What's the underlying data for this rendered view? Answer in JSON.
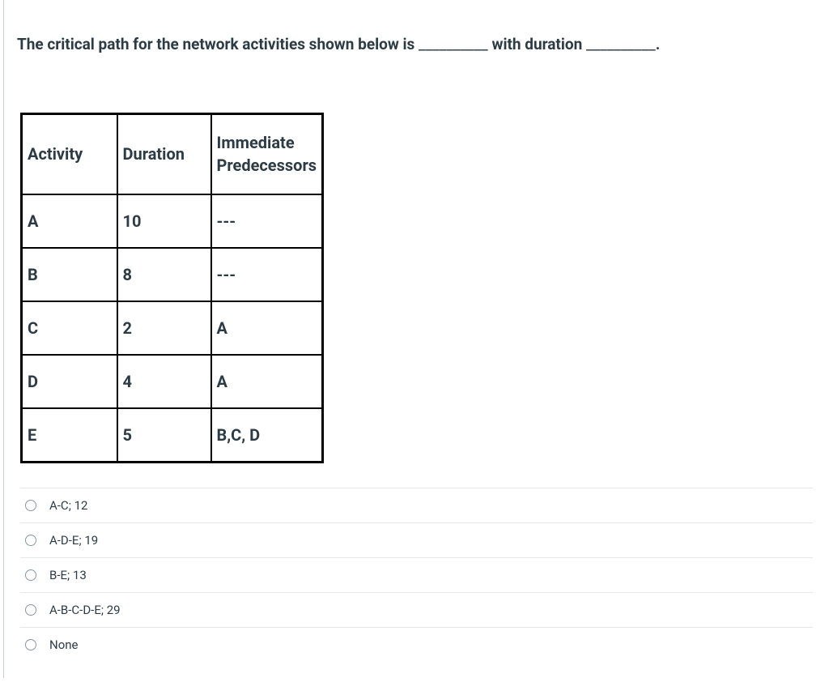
{
  "chart_data": {
    "type": "table",
    "columns": [
      "Activity",
      "Duration",
      "Immediate Predecessors"
    ],
    "rows": [
      [
        "A",
        "10",
        "---"
      ],
      [
        "B",
        "8",
        "---"
      ],
      [
        "C",
        "2",
        "A"
      ],
      [
        "D",
        "4",
        "A"
      ],
      [
        "E",
        "5",
        "B,C, D"
      ]
    ]
  },
  "question": {
    "prefix": "The critical path for the network activities shown below is ",
    "blank1": "__________",
    "mid": " with duration ",
    "blank2": "__________",
    "suffix": "."
  },
  "table": {
    "headers": {
      "activity": "Activity",
      "duration": "Duration",
      "pred_line1": "Immediate",
      "pred_line2": "Predecessors"
    },
    "rows": [
      {
        "activity": "A",
        "duration": "10",
        "pred": "---"
      },
      {
        "activity": "B",
        "duration": "8",
        "pred": "---"
      },
      {
        "activity": "C",
        "duration": "2",
        "pred": "A"
      },
      {
        "activity": "D",
        "duration": "4",
        "pred": "A"
      },
      {
        "activity": "E",
        "duration": "5",
        "pred": "B,C, D"
      }
    ]
  },
  "options": [
    {
      "label": "A-C; 12"
    },
    {
      "label": "A-D-E; 19"
    },
    {
      "label": "B-E; 13"
    },
    {
      "label": "A-B-C-D-E; 29"
    },
    {
      "label": "None"
    }
  ]
}
